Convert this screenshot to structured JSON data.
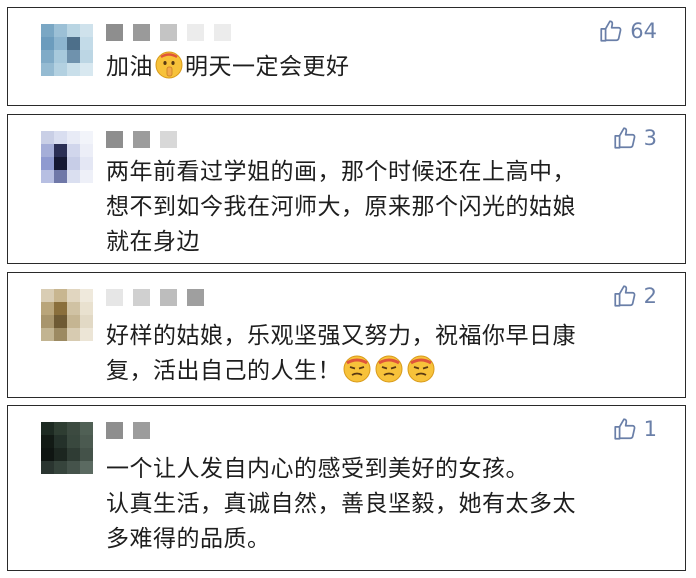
{
  "comments": [
    {
      "likes": "64",
      "line1_a": "加油",
      "line1_b": "明天一定会更好"
    },
    {
      "likes": "3",
      "line1": "两年前看过学姐的画，那个时候还在上高中，",
      "line2": "想不到如今我在河师大，原来那个闪光的姑娘",
      "line3": "就在身边"
    },
    {
      "likes": "2",
      "line1": "好样的姑娘，乐观坚强又努力，祝福你早日康",
      "line2": "复，活出自己的人生！"
    },
    {
      "likes": "1",
      "line1": "一个让人发自内心的感受到美好的女孩。",
      "line2": "认真生活，真诚自然，善良坚毅，她有太多太",
      "line3": "多难得的品质。"
    }
  ],
  "icons": {
    "like": "thumbs-up-icon",
    "emoji_shush": "shushing-face-emoji",
    "emoji_determined": "persevering-face-emoji"
  },
  "colors": {
    "like": "#6a7fa8",
    "border": "#2a2a2a",
    "text": "#1e1e1e"
  }
}
